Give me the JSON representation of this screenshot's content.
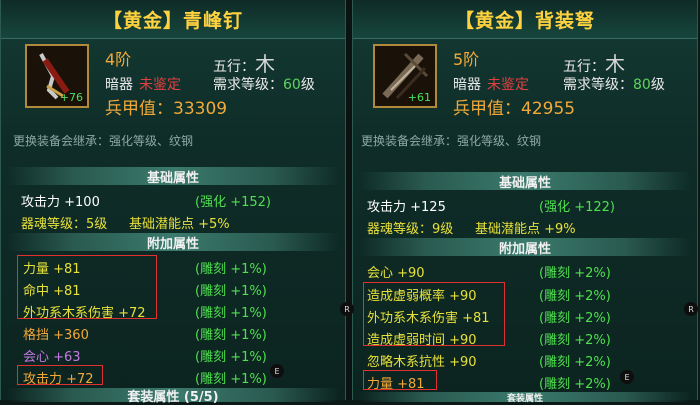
{
  "left": {
    "title": "【黄金】青峰钉",
    "tier": "4阶",
    "element_label": "五行：",
    "element_glyph": "木",
    "type": "暗器",
    "type_status": "未鉴定",
    "level_req_label": "需求等级：",
    "level_req_value": "60",
    "level_req_unit": "级",
    "armor": "兵甲值：33309",
    "icon_plus": "+76",
    "inherit": "更换装备会继承：强化等级、纹钢",
    "base_header": "基础属性",
    "attack": "攻击力 +100",
    "attack_bonus": "(强化 +152)",
    "soul_level": "器魂等级：5级",
    "base_potential": "基础潜能点 +5%",
    "extra_header": "附加属性",
    "extra": [
      {
        "name": "力量 +81",
        "bonus": "(雕刻 +1%)",
        "color": "y"
      },
      {
        "name": "命中 +81",
        "bonus": "(雕刻 +1%)",
        "color": "y"
      },
      {
        "name": "外功系木系伤害 +72",
        "bonus": "(雕刻 +1%)",
        "color": "y"
      },
      {
        "name": "格挡 +360",
        "bonus": "(雕刻 +1%)",
        "color": "o"
      },
      {
        "name": "会心 +63",
        "bonus": "(雕刻 +1%)",
        "color": "p"
      },
      {
        "name": "攻击力 +72",
        "bonus": "(雕刻 +1%)",
        "color": "o"
      }
    ],
    "set_header": "套装属性 (5/5)"
  },
  "right": {
    "title": "【黄金】背装弩",
    "tier": "5阶",
    "element_label": "五行：",
    "element_glyph": "木",
    "type": "暗器",
    "type_status": "未鉴定",
    "level_req_label": "需求等级：",
    "level_req_value": "80",
    "level_req_unit": "级",
    "armor": "兵甲值：42955",
    "icon_plus": "+61",
    "inherit": "更换装备会继承：强化等级、纹钢",
    "base_header": "基础属性",
    "attack": "攻击力 +125",
    "attack_bonus": "(强化 +122)",
    "soul_level": "器魂等级：9级",
    "base_potential": "基础潜能点 +9%",
    "extra_header": "附加属性",
    "extra": [
      {
        "name": "会心 +90",
        "bonus": "(雕刻 +2%)",
        "color": "y"
      },
      {
        "name": "造成虚弱概率 +90",
        "bonus": "(雕刻 +2%)",
        "color": "y"
      },
      {
        "name": "外功系木系伤害 +81",
        "bonus": "(雕刻 +2%)",
        "color": "y"
      },
      {
        "name": "造成虚弱时间 +90",
        "bonus": "(雕刻 +2%)",
        "color": "y"
      },
      {
        "name": "忽略木系抗性 +90",
        "bonus": "(雕刻 +2%)",
        "color": "y"
      },
      {
        "name": "力量 +81",
        "bonus": "(雕刻 +2%)",
        "color": "o"
      }
    ],
    "set_header": "套装属性"
  },
  "hud": {
    "r1": "R",
    "e1": "E",
    "r2": "R",
    "e2": "E"
  }
}
